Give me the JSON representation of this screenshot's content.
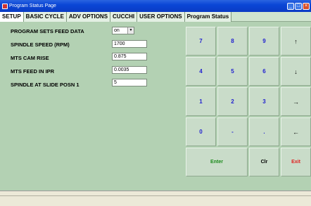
{
  "window": {
    "title": "Program Status Page"
  },
  "tabs": [
    "SETUP",
    "BASIC CYCLE",
    "ADV OPTIONS",
    "CUCCHI",
    "USER OPTIONS",
    "Program Status"
  ],
  "fields": [
    {
      "label": "PROGRAM SETS FEED DATA",
      "value": "on",
      "kind": "select"
    },
    {
      "label": "SPINDLE SPEED (RPM)",
      "value": "1700",
      "kind": "input"
    },
    {
      "label": "MTS CAM RISE",
      "value": "0.875",
      "kind": "input"
    },
    {
      "label": "MTS FEED IN IPR",
      "value": "0.0035",
      "kind": "input"
    },
    {
      "label": "SPINDLE AT SLIDE POSN 1",
      "value": "5",
      "kind": "input"
    }
  ],
  "keypad": {
    "keys": [
      "7",
      "8",
      "9",
      "↑",
      "4",
      "5",
      "6",
      "↓",
      "1",
      "2",
      "3",
      "→",
      "0",
      "-",
      ".",
      "←"
    ],
    "enter": "Enter",
    "clr": "Clr",
    "exit": "Exit"
  },
  "colors": {
    "panel": "#b3d1b3",
    "titlebar": "#0a46d6",
    "digit": "#2020d0",
    "enter": "#1a8a1a",
    "exit": "#e02020"
  }
}
